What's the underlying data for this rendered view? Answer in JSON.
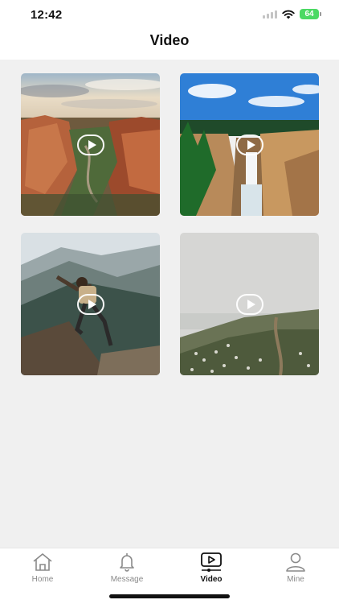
{
  "status": {
    "time": "12:42",
    "battery": "64"
  },
  "header": {
    "title": "Video"
  },
  "videos": [
    {
      "scene": "canyon"
    },
    {
      "scene": "waterfall"
    },
    {
      "scene": "hiker"
    },
    {
      "scene": "meadow"
    }
  ],
  "tabs": [
    {
      "label": "Home",
      "icon": "home-icon"
    },
    {
      "label": "Message",
      "icon": "bell-icon"
    },
    {
      "label": "Video",
      "icon": "video-play-icon",
      "active": true
    },
    {
      "label": "Mine",
      "icon": "person-icon"
    }
  ],
  "colors": {
    "accent": "#111111",
    "battery": "#4cd964",
    "inactive_tab": "#8a8a8a",
    "background": "#f0f0f0"
  }
}
